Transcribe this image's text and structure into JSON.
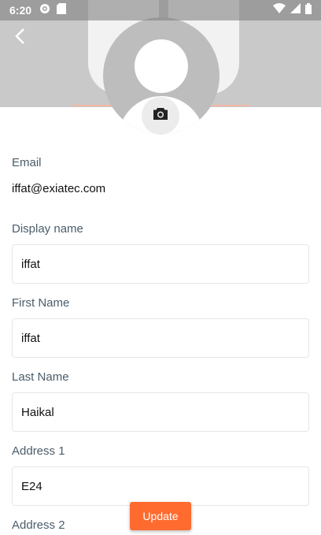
{
  "status_bar": {
    "time": "6:20",
    "left_icons": [
      "settings-icon",
      "sd-card-icon"
    ],
    "right_icons": [
      "wifi-icon",
      "signal-icon",
      "battery-icon"
    ]
  },
  "header": {
    "back_icon": "chevron-left-icon",
    "avatar_icon": "default-avatar",
    "camera_icon": "camera-icon"
  },
  "form": {
    "email": {
      "label": "Email",
      "value": "iffat@exiatec.com"
    },
    "display_name": {
      "label": "Display name",
      "value": "iffat"
    },
    "first_name": {
      "label": "First Name",
      "value": "iffat"
    },
    "last_name": {
      "label": "Last Name",
      "value": "Haikal"
    },
    "address1": {
      "label": "Address 1",
      "value": "E24"
    },
    "address2": {
      "label": "Address 2"
    }
  },
  "actions": {
    "update_label": "Update"
  },
  "colors": {
    "accent": "#ff6b2e",
    "label": "#4a5d6b",
    "header_bg": "#c9c9c9"
  }
}
